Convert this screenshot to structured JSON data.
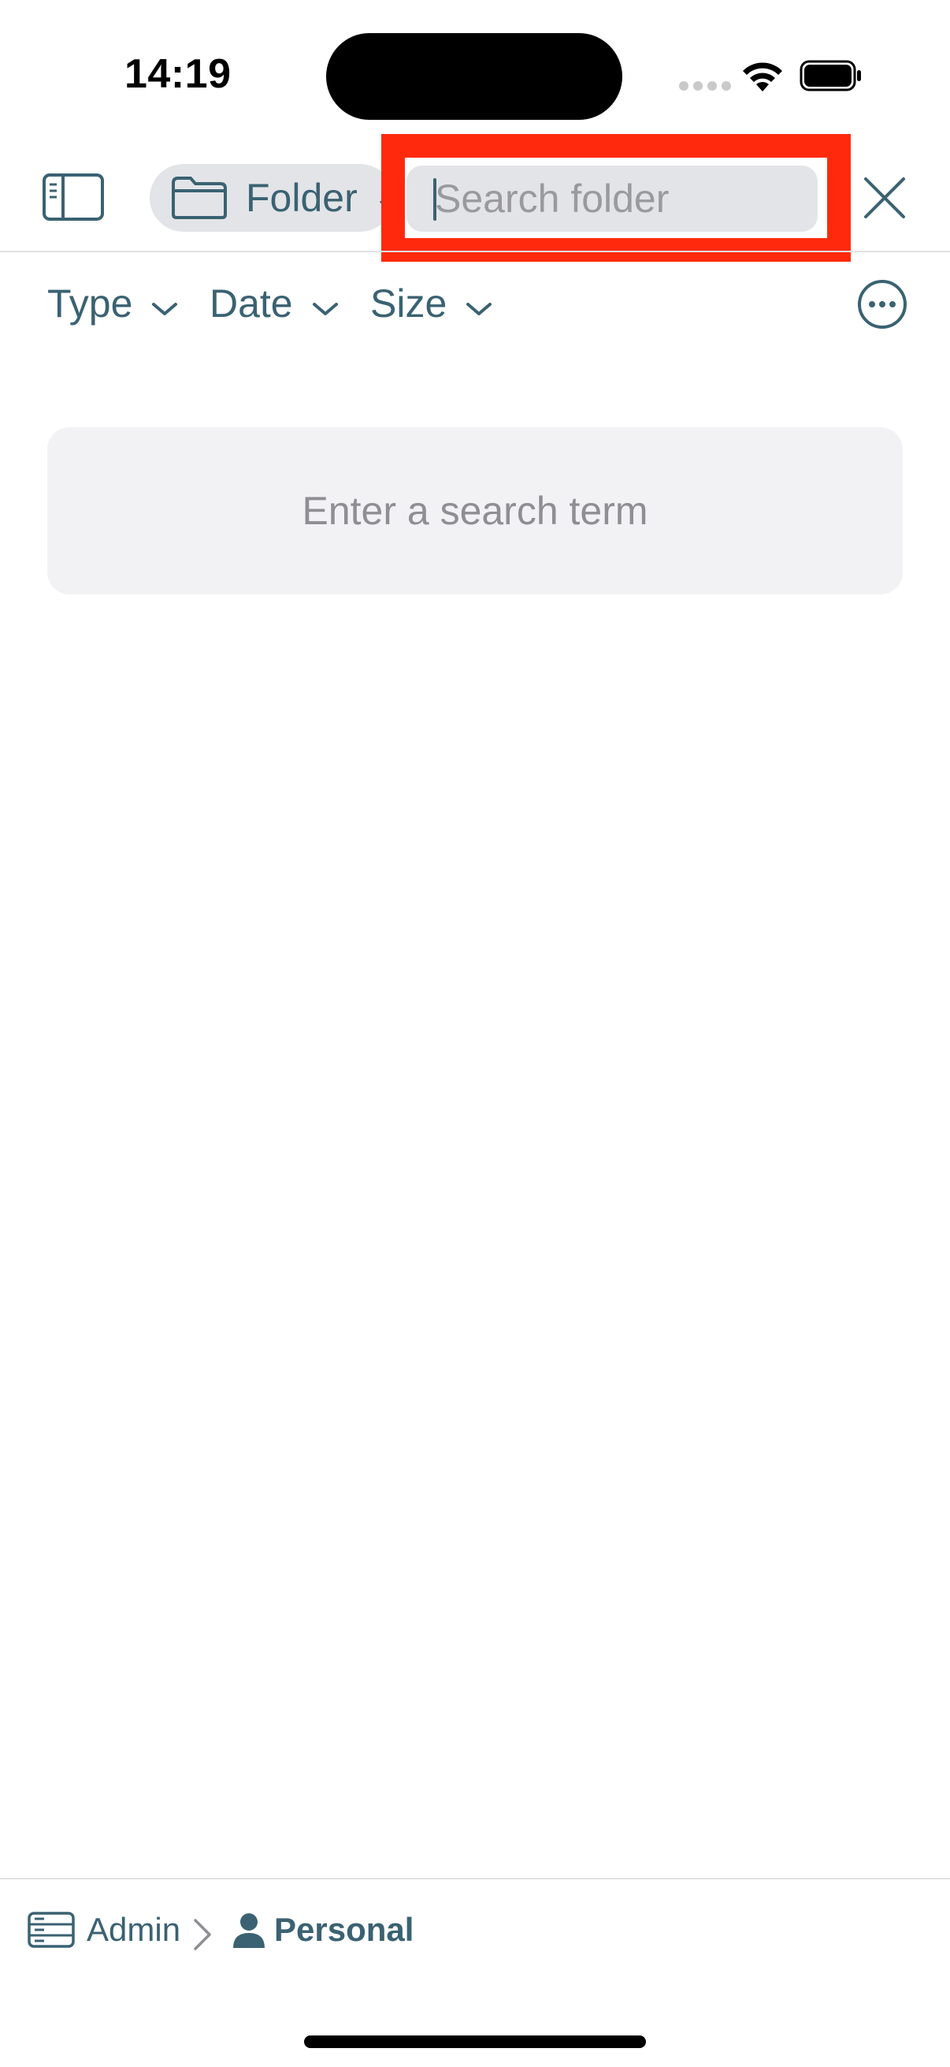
{
  "status_bar": {
    "time": "14:19"
  },
  "toolbar": {
    "folder_label": "Folder",
    "search": {
      "value": "",
      "placeholder": "Search folder"
    }
  },
  "filters": [
    {
      "label": "Type"
    },
    {
      "label": "Date"
    },
    {
      "label": "Size"
    }
  ],
  "empty_state": {
    "message": "Enter a search term"
  },
  "breadcrumb": {
    "items": [
      {
        "label": "Admin",
        "icon": "server-icon"
      },
      {
        "label": "Personal",
        "icon": "person-icon"
      }
    ]
  },
  "colors": {
    "accent": "#3a6272",
    "highlight": "#ff2a0d",
    "field_bg": "#e3e4e7",
    "card_bg": "#f2f2f5",
    "placeholder": "#9a9a9e"
  }
}
